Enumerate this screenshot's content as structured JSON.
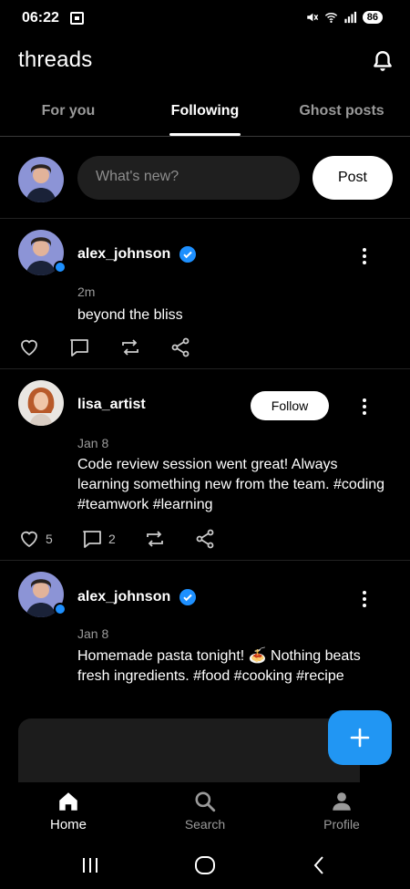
{
  "status_bar": {
    "time": "06:22",
    "battery": "86"
  },
  "header": {
    "title": "threads"
  },
  "tabs": [
    {
      "label": "For you"
    },
    {
      "label": "Following"
    },
    {
      "label": "Ghost posts"
    }
  ],
  "composer": {
    "placeholder": "What's new?",
    "post_label": "Post"
  },
  "posts": [
    {
      "username": "alex_johnson",
      "verified": true,
      "time": "2m",
      "text": "beyond the bliss",
      "likes": "",
      "comments": ""
    },
    {
      "username": "lisa_artist",
      "verified": false,
      "follow_label": "Follow",
      "time": "Jan 8",
      "text": "Code review session went great! Always learning something new from the team. #coding #teamwork #learning",
      "likes": "5",
      "comments": "2"
    },
    {
      "username": "alex_johnson",
      "verified": true,
      "time": "Jan 8",
      "text": "Homemade pasta tonight! 🍝 Nothing beats fresh ingredients. #food #cooking #recipe",
      "likes": "",
      "comments": ""
    }
  ],
  "bottom_nav": [
    {
      "label": "Home",
      "icon": "home-icon"
    },
    {
      "label": "Search",
      "icon": "search-icon"
    },
    {
      "label": "Profile",
      "icon": "profile-icon"
    }
  ],
  "colors": {
    "accent": "#2196f3",
    "verified": "#1e90ff",
    "background": "#000000"
  }
}
